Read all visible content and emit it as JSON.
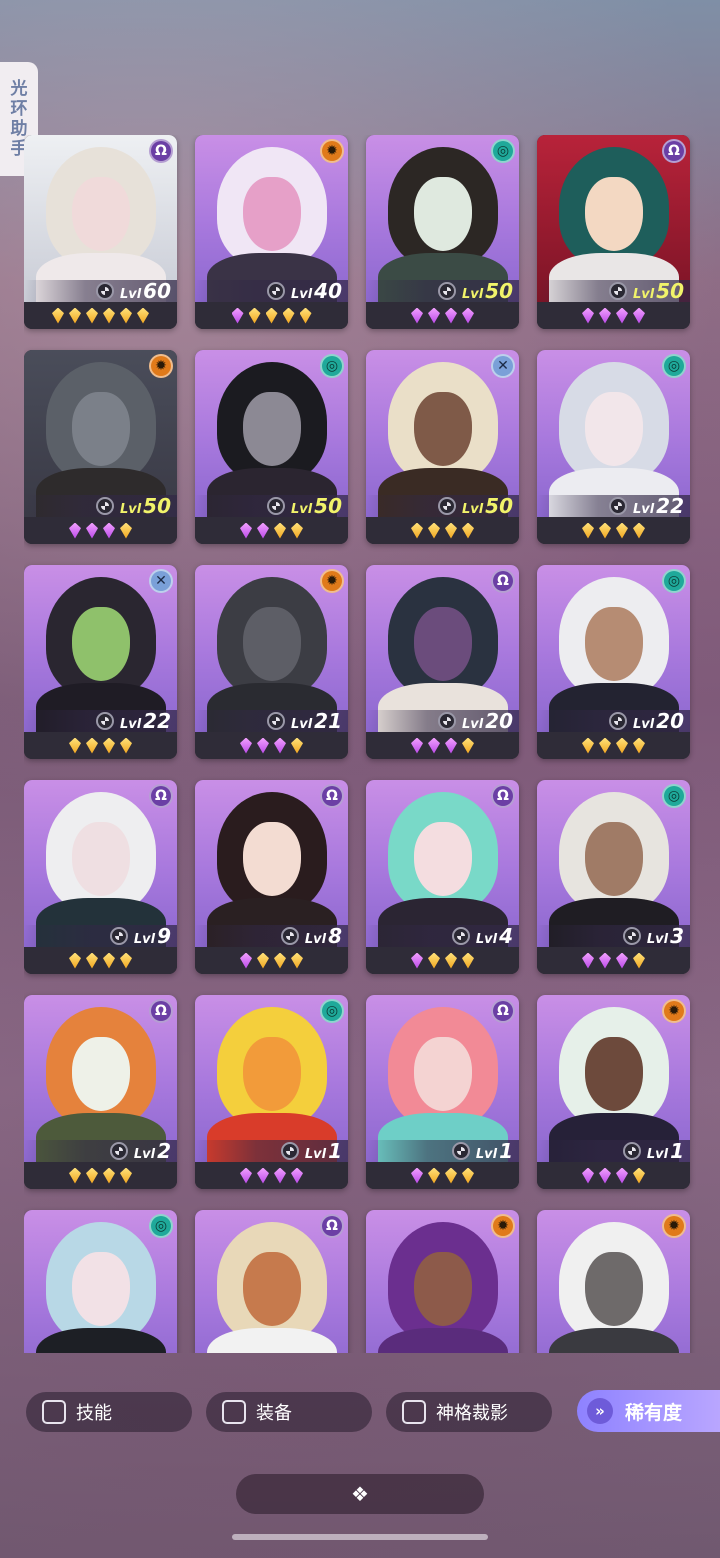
{
  "side_tab": {
    "label": [
      "光",
      "环",
      "助",
      "手"
    ]
  },
  "heroes": [
    {
      "level": "60",
      "lvl_label": "Lvl",
      "class_icon": "omega",
      "class_color": "purple",
      "theme": "light",
      "gems": [
        "gold",
        "gold",
        "gold",
        "gold",
        "gold",
        "gold"
      ],
      "max": false,
      "hair": "#e7e1d9",
      "face": "#f0dada",
      "body": "#efe9ea"
    },
    {
      "level": "40",
      "lvl_label": "Lvl",
      "class_icon": "gear",
      "class_color": "orange",
      "theme": "pink",
      "gems": [
        "purple",
        "gold",
        "gold",
        "gold",
        "gold"
      ],
      "max": false,
      "hair": "#f0e6f5",
      "face": "#e6a0c8",
      "body": "#3a3346"
    },
    {
      "level": "50",
      "lvl_label": "Lvl",
      "class_icon": "swirl",
      "class_color": "teal",
      "theme": "pink",
      "gems": [
        "purple",
        "purple",
        "purple",
        "purple"
      ],
      "max": true,
      "hair": "#2c2724",
      "face": "#dfe9df",
      "body": "#3b4b45"
    },
    {
      "level": "50",
      "lvl_label": "Lvl",
      "class_icon": "omega",
      "class_color": "purple",
      "theme": "red",
      "gems": [
        "purple",
        "purple",
        "purple",
        "purple"
      ],
      "max": true,
      "hair": "#1e5e5b",
      "face": "#f3d8c2",
      "body": "#e9e6e6"
    },
    {
      "level": "50",
      "lvl_label": "Lvl",
      "class_icon": "gear",
      "class_color": "orange",
      "theme": "dark",
      "gems": [
        "purple",
        "purple",
        "purple",
        "gold"
      ],
      "max": true,
      "hair": "#5b6068",
      "face": "#7b8089",
      "body": "#2e2b2c"
    },
    {
      "level": "50",
      "lvl_label": "Lvl",
      "class_icon": "swirl",
      "class_color": "teal",
      "theme": "pink",
      "gems": [
        "purple",
        "purple",
        "gold",
        "gold"
      ],
      "max": true,
      "hair": "#1b1b20",
      "face": "#8c8994",
      "body": "#2b2530"
    },
    {
      "level": "50",
      "lvl_label": "Lvl",
      "class_icon": "cross",
      "class_color": "blue",
      "theme": "pink",
      "gems": [
        "gold",
        "gold",
        "gold",
        "gold"
      ],
      "max": true,
      "hair": "#eadfc8",
      "face": "#7f5a48",
      "body": "#3a2b24"
    },
    {
      "level": "22",
      "lvl_label": "Lvl",
      "class_icon": "swirl",
      "class_color": "teal",
      "theme": "pink",
      "gems": [
        "gold",
        "gold",
        "gold",
        "gold"
      ],
      "max": false,
      "hair": "#d7dbe6",
      "face": "#f2e6ea",
      "body": "#ececf1"
    },
    {
      "level": "22",
      "lvl_label": "Lvl",
      "class_icon": "cross",
      "class_color": "blue",
      "theme": "pink",
      "gems": [
        "gold",
        "gold",
        "gold",
        "gold"
      ],
      "max": false,
      "hair": "#2a2630",
      "face": "#8fc16b",
      "body": "#1f1c25"
    },
    {
      "level": "21",
      "lvl_label": "Lvl",
      "class_icon": "gear",
      "class_color": "orange",
      "theme": "pink",
      "gems": [
        "purple",
        "purple",
        "purple",
        "gold"
      ],
      "max": false,
      "hair": "#3c3d44",
      "face": "#5d5e66",
      "body": "#2a2b31"
    },
    {
      "level": "20",
      "lvl_label": "Lvl",
      "class_icon": "omega",
      "class_color": "purple",
      "theme": "pink",
      "gems": [
        "purple",
        "purple",
        "purple",
        "gold"
      ],
      "max": false,
      "hair": "#2a3240",
      "face": "#6b4c7c",
      "body": "#e9e2dc"
    },
    {
      "level": "20",
      "lvl_label": "Lvl",
      "class_icon": "swirl",
      "class_color": "teal",
      "theme": "pink",
      "gems": [
        "gold",
        "gold",
        "gold",
        "gold"
      ],
      "max": false,
      "hair": "#ededf0",
      "face": "#b68c73",
      "body": "#232331"
    },
    {
      "level": "9",
      "lvl_label": "Lvl",
      "class_icon": "omega",
      "class_color": "purple",
      "theme": "pink",
      "gems": [
        "gold",
        "gold",
        "gold",
        "gold"
      ],
      "max": false,
      "hair": "#eeeef0",
      "face": "#efdfe2",
      "body": "#23323a"
    },
    {
      "level": "8",
      "lvl_label": "Lvl",
      "class_icon": "omega",
      "class_color": "purple",
      "theme": "pink",
      "gems": [
        "purple",
        "gold",
        "gold",
        "gold"
      ],
      "max": false,
      "hair": "#2a1c1e",
      "face": "#f3dcd2",
      "body": "#2a2022"
    },
    {
      "level": "4",
      "lvl_label": "Lvl",
      "class_icon": "omega",
      "class_color": "purple",
      "theme": "pink",
      "gems": [
        "purple",
        "gold",
        "gold",
        "gold"
      ],
      "max": false,
      "hair": "#79d9c8",
      "face": "#f4dde0",
      "body": "#2b2533"
    },
    {
      "level": "3",
      "lvl_label": "Lvl",
      "class_icon": "swirl",
      "class_color": "teal",
      "theme": "pink",
      "gems": [
        "purple",
        "purple",
        "purple",
        "gold"
      ],
      "max": false,
      "hair": "#e7e4df",
      "face": "#a07b66",
      "body": "#1f1d23"
    },
    {
      "level": "2",
      "lvl_label": "Lvl",
      "class_icon": "omega",
      "class_color": "purple",
      "theme": "pink",
      "gems": [
        "gold",
        "gold",
        "gold",
        "gold"
      ],
      "max": false,
      "hair": "#e5823c",
      "face": "#eef1e8",
      "body": "#4d5a3b"
    },
    {
      "level": "1",
      "lvl_label": "Lvl",
      "class_icon": "swirl",
      "class_color": "teal",
      "theme": "pink",
      "gems": [
        "purple",
        "purple",
        "purple",
        "purple"
      ],
      "max": false,
      "hair": "#f4cf3c",
      "face": "#f29b3a",
      "body": "#d93c2a"
    },
    {
      "level": "1",
      "lvl_label": "Lvl",
      "class_icon": "omega",
      "class_color": "purple",
      "theme": "pink",
      "gems": [
        "purple",
        "gold",
        "gold",
        "gold"
      ],
      "max": false,
      "hair": "#f28a96",
      "face": "#f4d3d2",
      "body": "#6ecfc7"
    },
    {
      "level": "1",
      "lvl_label": "Lvl",
      "class_icon": "gear",
      "class_color": "orange",
      "theme": "pink",
      "gems": [
        "purple",
        "purple",
        "purple",
        "gold"
      ],
      "max": false,
      "hair": "#e6f0e9",
      "face": "#6d4a3c",
      "body": "#262138"
    },
    {
      "level": "",
      "lvl_label": "",
      "class_icon": "swirl",
      "class_color": "teal",
      "theme": "pink",
      "gems": [],
      "max": false,
      "hair": "#b8d8e6",
      "face": "#f2e1e6",
      "body": "#1d1f25"
    },
    {
      "level": "",
      "lvl_label": "",
      "class_icon": "omega",
      "class_color": "purple",
      "theme": "pink",
      "gems": [],
      "max": false,
      "hair": "#e8d8b8",
      "face": "#c67a4d",
      "body": "#f2f2f2"
    },
    {
      "level": "",
      "lvl_label": "",
      "class_icon": "gear",
      "class_color": "orange",
      "theme": "pink",
      "gems": [],
      "max": false,
      "hair": "#6b2f8f",
      "face": "#8d5a4a",
      "body": "#5a2c7c"
    },
    {
      "level": "",
      "lvl_label": "",
      "class_icon": "gear",
      "class_color": "orange",
      "theme": "pink",
      "gems": [],
      "max": false,
      "hair": "#f0f0f0",
      "face": "#6e6a6a",
      "body": "#3a3a40"
    }
  ],
  "filters": {
    "skill": "技能",
    "equipment": "装备",
    "divine": "神格裁影",
    "rarity": "稀有度"
  },
  "collapse": {
    "icon": "❖"
  }
}
